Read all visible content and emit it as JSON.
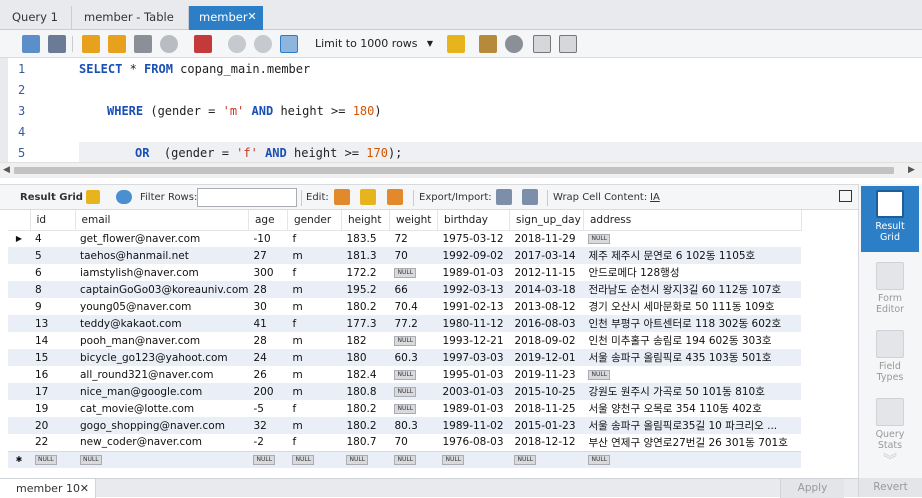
{
  "tabs": [
    {
      "label": "Query 1"
    },
    {
      "label": "member - Table"
    },
    {
      "label": "member"
    }
  ],
  "sql_toolbar": {
    "limit_select": "Limit to 1000 rows"
  },
  "editor": {
    "line_numbers": [
      "1",
      "2",
      "3",
      "4",
      "5"
    ],
    "line1": {
      "kw1": "SELECT",
      "rest1": " * ",
      "kw2": "FROM",
      "rest2": " copang_main.member"
    },
    "line3": {
      "kw1": "WHERE",
      "p1": " (gender = ",
      "s1": "'m'",
      "p2": " ",
      "kw2": "AND",
      "p3": " height >= ",
      "n1": "180",
      "p4": ")"
    },
    "line5": {
      "kw1": "OR",
      "p1": "  (gender = ",
      "s1": "'f'",
      "p2": " ",
      "kw2": "AND",
      "p3": " height >= ",
      "n1": "170",
      "p4": ");"
    }
  },
  "result_toolbar": {
    "result_grid": "Result Grid",
    "filter_rows": "Filter Rows:",
    "edit": "Edit:",
    "export_import": "Export/Import:",
    "wrap": "Wrap Cell Content:",
    "wrap_icon": "IA"
  },
  "grid": {
    "columns": [
      "id",
      "email",
      "age",
      "gender",
      "height",
      "weight",
      "birthday",
      "sign_up_day",
      "address"
    ],
    "null_label": "NULL",
    "rows": [
      [
        "4",
        "get_flower@naver.com",
        "-10",
        "f",
        "183.5",
        "72",
        "1975-03-12",
        "2018-11-29",
        null
      ],
      [
        "5",
        "taehos@hanmail.net",
        "27",
        "m",
        "181.3",
        "70",
        "1992-09-02",
        "2017-03-14",
        "제주 제주시 문연로 6 102동 1105호"
      ],
      [
        "6",
        "iamstylish@naver.com",
        "300",
        "f",
        "172.2",
        null,
        "1989-01-03",
        "2012-11-15",
        "안드로메다 128행성"
      ],
      [
        "8",
        "captainGoGo03@koreauniv.com",
        "28",
        "m",
        "195.2",
        "66",
        "1992-03-13",
        "2014-03-18",
        "전라남도 순천시 왕지3길 60 112동 107호"
      ],
      [
        "9",
        "young05@naver.com",
        "30",
        "m",
        "180.2",
        "70.4",
        "1991-02-13",
        "2013-08-12",
        "경기 오산시 세마문화로 50 111동 109호"
      ],
      [
        "13",
        "teddy@kakaot.com",
        "41",
        "f",
        "177.3",
        "77.2",
        "1980-11-12",
        "2016-08-03",
        "인천 부평구 아트센터로 118 302동 602호"
      ],
      [
        "14",
        "pooh_man@naver.com",
        "28",
        "m",
        "182",
        null,
        "1993-12-21",
        "2018-09-02",
        "인천 미추홀구 송림로 194 602동 303호"
      ],
      [
        "15",
        "bicycle_go123@yahoot.com",
        "24",
        "m",
        "180",
        "60.3",
        "1997-03-03",
        "2019-12-01",
        "서울 송파구 올림픽로 435 103동 501호"
      ],
      [
        "16",
        "all_round321@naver.com",
        "26",
        "m",
        "182.4",
        null,
        "1995-01-03",
        "2019-11-23",
        null
      ],
      [
        "17",
        "nice_man@google.com",
        "200",
        "m",
        "180.8",
        null,
        "2003-01-03",
        "2015-10-25",
        "강원도 원주시 가곡로 50 101동 810호"
      ],
      [
        "19",
        "cat_movie@lotte.com",
        "-5",
        "f",
        "180.2",
        null,
        "1989-01-03",
        "2018-11-25",
        "서울 양천구 오목로 354 110동 402호"
      ],
      [
        "20",
        "gogo_shopping@naver.com",
        "32",
        "m",
        "180.2",
        "80.3",
        "1989-11-02",
        "2015-01-23",
        "서울 송파구 올림픽로35길 10 파크리오 ..."
      ],
      [
        "22",
        "new_coder@naver.com",
        "-2",
        "f",
        "180.7",
        "70",
        "1976-08-03",
        "2018-12-12",
        "부산 연제구 양연로27번길 26 301동 701호"
      ]
    ]
  },
  "sidebar": [
    {
      "label1": "Result",
      "label2": "Grid"
    },
    {
      "label1": "Form",
      "label2": "Editor"
    },
    {
      "label1": "Field",
      "label2": "Types"
    },
    {
      "label1": "Query",
      "label2": "Stats"
    }
  ],
  "bottom": {
    "tab": "member 10",
    "apply": "Apply",
    "revert": "Revert"
  },
  "colors": {
    "accent": "#2c7fc7",
    "row_alt": "#e9eef7",
    "keyword": "#1a4fb4",
    "string": "#c23a2a",
    "number": "#d35400"
  }
}
